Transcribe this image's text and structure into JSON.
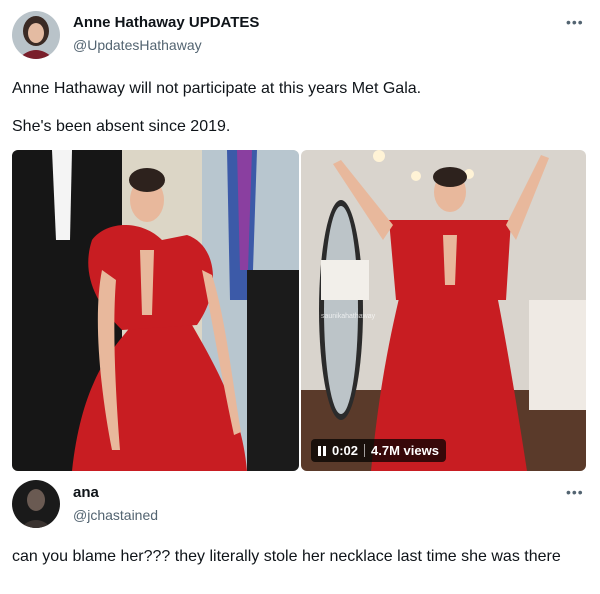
{
  "tweet": {
    "display_name": "Anne Hathaway UPDATES",
    "handle": "@UpdatesHathaway",
    "more_icon": "•••",
    "line1": "Anne Hathaway will not participate at this years Met Gala.",
    "line2": "She's been absent since 2019.",
    "video": {
      "time": "0:02",
      "views": "4.7M views",
      "watermark": "saunikahathaway"
    }
  },
  "reply": {
    "display_name": "ana",
    "handle": "@jchastained",
    "more_icon": "•••",
    "text": "can you blame her??? they literally  stole her necklace last time she was there"
  },
  "colors": {
    "dress_red": "#c81d22",
    "handle_gray": "#536471",
    "text_black": "#0f1419"
  }
}
